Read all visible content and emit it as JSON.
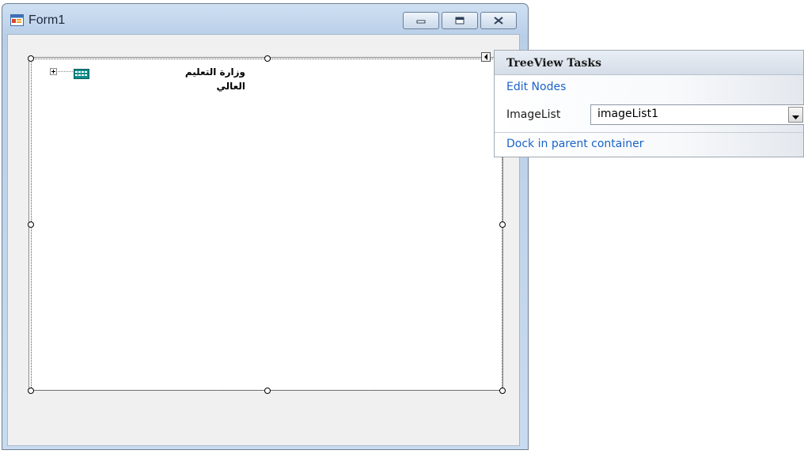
{
  "window": {
    "title": "Form1",
    "app_icon": "form-icon",
    "buttons": [
      {
        "name": "minimize",
        "icon": "minimize-icon"
      },
      {
        "name": "maximize",
        "icon": "maximize-icon"
      },
      {
        "name": "close",
        "icon": "close-icon"
      }
    ]
  },
  "treeview": {
    "nodes": [
      {
        "label": "وزارة التعليم العالي",
        "expander": "+",
        "icon": "calendar-table-icon"
      }
    ]
  },
  "smart_tag": {
    "icon": "smart-tag-arrow-icon",
    "panel_title": "TreeView Tasks",
    "edit_nodes_link": "Edit Nodes",
    "imagelist_label": "ImageList",
    "imagelist_value": "imageList1",
    "dock_link": "Dock in parent container"
  },
  "colors": {
    "link": "#1a63c8",
    "frame": "#b9cfe8",
    "client_bg": "#f0f0f0"
  }
}
